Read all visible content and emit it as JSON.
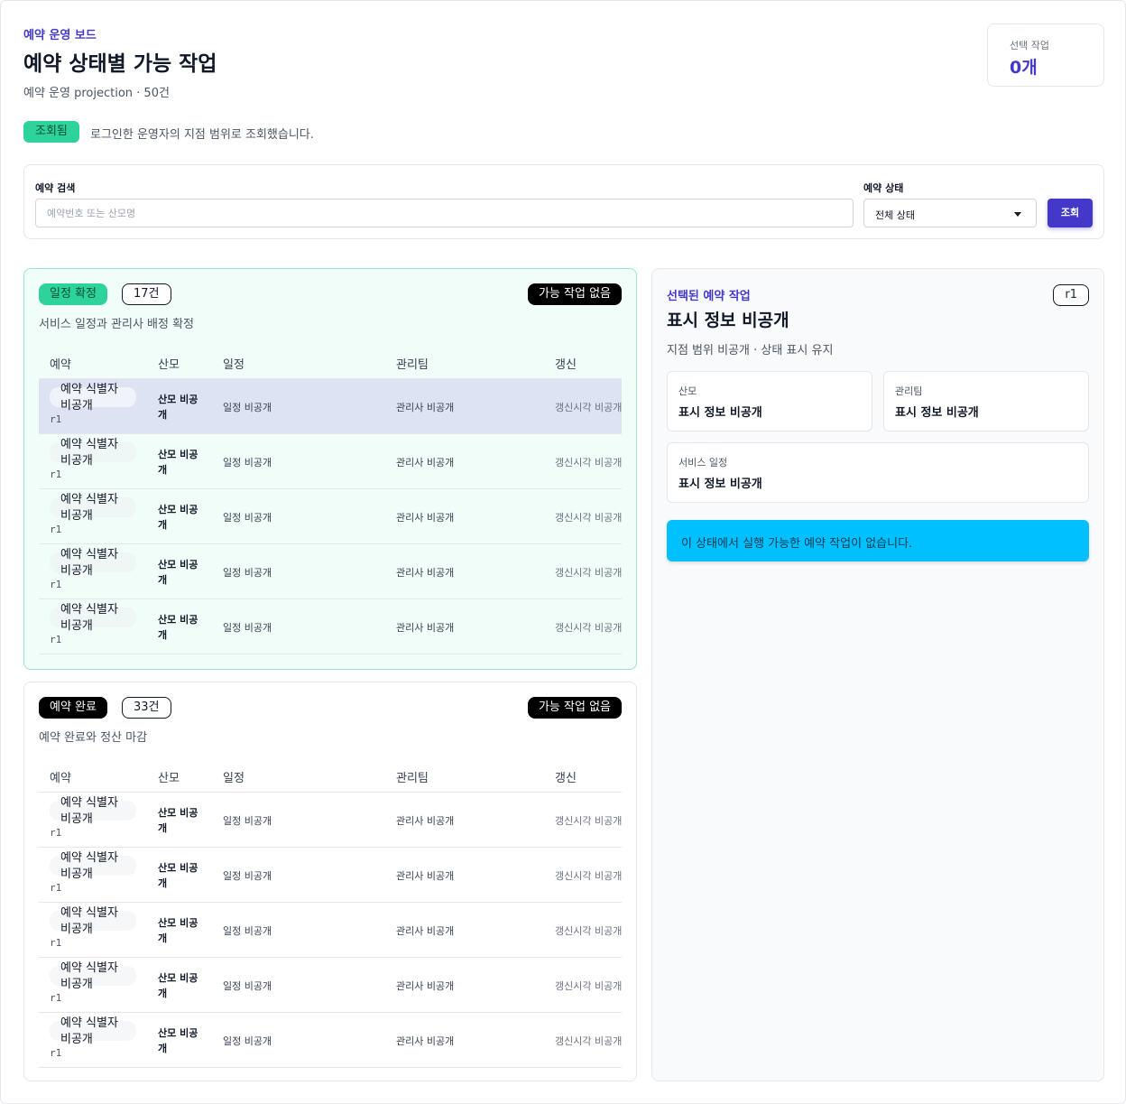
{
  "header": {
    "eyebrow": "예약 운영 보드",
    "title": "예약 상태별 가능 작업",
    "subtitle": "예약 운영 projection · 50건"
  },
  "selected_card": {
    "label": "선택 작업",
    "value": "0개"
  },
  "status": {
    "badge": "조회됨",
    "text": "로그인한 운영자의 지점 범위로 조회했습니다."
  },
  "filter": {
    "search_label": "예약 검색",
    "search_placeholder": "예약번호 또는 산모명",
    "search_value": "",
    "state_label": "예약 상태",
    "state_value": "전체 상태",
    "submit_label": "조회"
  },
  "columns": [
    "예약",
    "산모",
    "일정",
    "관리팀",
    "갱신"
  ],
  "groups": [
    {
      "state": "일정 확정",
      "count": "17건",
      "actions": "가능 작업 없음",
      "description": "서비스 일정과 관리사 배정 확정",
      "rows": [
        {
          "id": "예약 식별자 비공개",
          "rev": "r1",
          "mother": "산모 비공개",
          "schedule": "일정 비공개",
          "team": "관리사 비공개",
          "updated": "갱신시각 비공개"
        },
        {
          "id": "예약 식별자 비공개",
          "rev": "r1",
          "mother": "산모 비공개",
          "schedule": "일정 비공개",
          "team": "관리사 비공개",
          "updated": "갱신시각 비공개"
        },
        {
          "id": "예약 식별자 비공개",
          "rev": "r1",
          "mother": "산모 비공개",
          "schedule": "일정 비공개",
          "team": "관리사 비공개",
          "updated": "갱신시각 비공개"
        },
        {
          "id": "예약 식별자 비공개",
          "rev": "r1",
          "mother": "산모 비공개",
          "schedule": "일정 비공개",
          "team": "관리사 비공개",
          "updated": "갱신시각 비공개"
        },
        {
          "id": "예약 식별자 비공개",
          "rev": "r1",
          "mother": "산모 비공개",
          "schedule": "일정 비공개",
          "team": "관리사 비공개",
          "updated": "갱신시각 비공개"
        }
      ]
    },
    {
      "state": "예약 완료",
      "count": "33건",
      "actions": "가능 작업 없음",
      "description": "예약 완료와 정산 마감",
      "rows": [
        {
          "id": "예약 식별자 비공개",
          "rev": "r1",
          "mother": "산모 비공개",
          "schedule": "일정 비공개",
          "team": "관리사 비공개",
          "updated": "갱신시각 비공개"
        },
        {
          "id": "예약 식별자 비공개",
          "rev": "r1",
          "mother": "산모 비공개",
          "schedule": "일정 비공개",
          "team": "관리사 비공개",
          "updated": "갱신시각 비공개"
        },
        {
          "id": "예약 식별자 비공개",
          "rev": "r1",
          "mother": "산모 비공개",
          "schedule": "일정 비공개",
          "team": "관리사 비공개",
          "updated": "갱신시각 비공개"
        },
        {
          "id": "예약 식별자 비공개",
          "rev": "r1",
          "mother": "산모 비공개",
          "schedule": "일정 비공개",
          "team": "관리사 비공개",
          "updated": "갱신시각 비공개"
        },
        {
          "id": "예약 식별자 비공개",
          "rev": "r1",
          "mother": "산모 비공개",
          "schedule": "일정 비공개",
          "team": "관리사 비공개",
          "updated": "갱신시각 비공개"
        }
      ]
    }
  ],
  "detail": {
    "eyebrow": "선택된 예약 작업",
    "rev": "r1",
    "title": "표시 정보 비공개",
    "subtitle": "지점 범위 비공개 · 상태 표시 유지",
    "fields": [
      {
        "label": "산모",
        "value": "표시 정보 비공개"
      },
      {
        "label": "관리팀",
        "value": "표시 정보 비공개"
      },
      {
        "label": "서비스 일정",
        "value": "표시 정보 비공개"
      }
    ],
    "alert": "이 상태에서 실행 가능한 예약 작업이 없습니다."
  },
  "colors": {
    "accent": "#4338ca",
    "confirm_badge": "#2ed39b",
    "alert": "#00c0ff",
    "selected_row": "#dde3f3"
  }
}
